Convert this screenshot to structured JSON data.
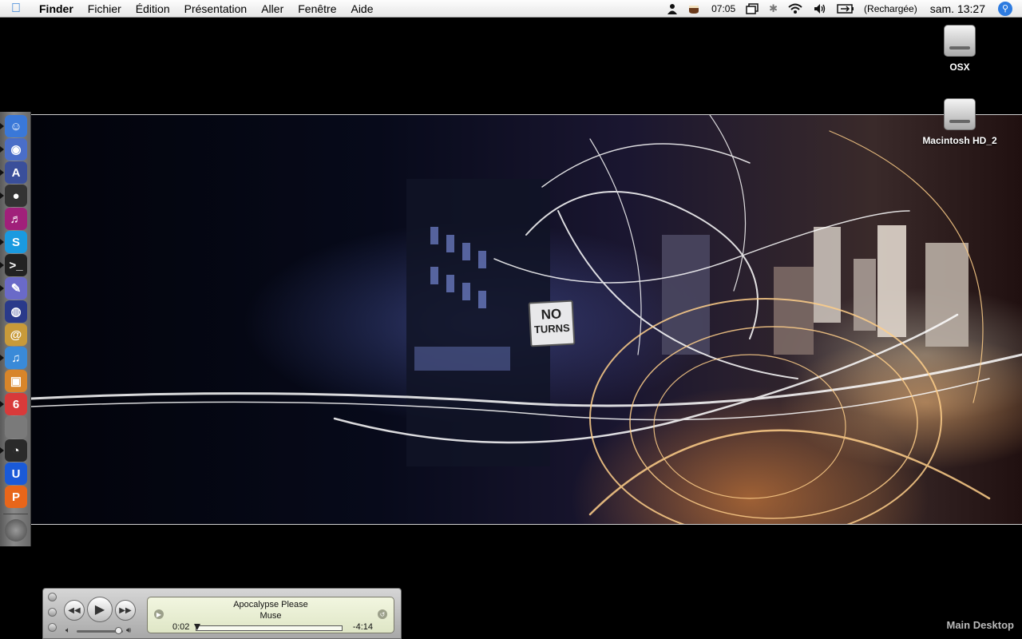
{
  "menubar": {
    "apple_icon": "apple-icon",
    "app_name": "Finder",
    "menus": [
      "Fichier",
      "Édition",
      "Présentation",
      "Aller",
      "Fenêtre",
      "Aide"
    ],
    "clock_alt": "07:05",
    "battery_status": "(Rechargée)",
    "clock": "sam. 13:27"
  },
  "wallpaper": {
    "sign_line1": "NO",
    "sign_line2": "TURNS"
  },
  "desktop": {
    "drives": [
      {
        "label": "OSX",
        "icon": "hard-drive-icon"
      },
      {
        "label": "Macintosh HD_2",
        "icon": "hard-drive-icon"
      }
    ],
    "desktop_name": "Main Desktop"
  },
  "dock": {
    "items": [
      {
        "name": "finder",
        "glyph": "☺",
        "color": "#3a78d8",
        "running": true
      },
      {
        "name": "firefox",
        "glyph": "◉",
        "color": "#4a6ec8",
        "running": true
      },
      {
        "name": "xcode",
        "glyph": "A",
        "color": "#3a4f9a",
        "running": true
      },
      {
        "name": "adium",
        "glyph": "●",
        "color": "#333333",
        "running": true
      },
      {
        "name": "itunes-alt",
        "glyph": "♬",
        "color": "#a0207a",
        "running": false
      },
      {
        "name": "skype",
        "glyph": "S",
        "color": "#1a9ae0",
        "running": true
      },
      {
        "name": "terminal",
        "glyph": ">_",
        "color": "#222222",
        "running": true
      },
      {
        "name": "script-editor",
        "glyph": "✎",
        "color": "#6a6ac8",
        "running": true
      },
      {
        "name": "network",
        "glyph": "◍",
        "color": "#2a3a8a",
        "running": false
      },
      {
        "name": "address-book",
        "glyph": "@",
        "color": "#c89a3a",
        "running": false
      },
      {
        "name": "itunes",
        "glyph": "♫",
        "color": "#3a8ad8",
        "running": true
      },
      {
        "name": "iphoto",
        "glyph": "▣",
        "color": "#d8852a",
        "running": false
      },
      {
        "name": "ical",
        "glyph": "6",
        "color": "#d83a3a",
        "running": true
      },
      {
        "name": "system-preferences",
        "glyph": "",
        "color": "#7a7a7a",
        "running": false
      },
      {
        "name": "time-machine",
        "glyph": "◔",
        "color": "#2a2a2a",
        "running": true
      },
      {
        "name": "audio-app",
        "glyph": "U",
        "color": "#1a5ad8",
        "running": false
      },
      {
        "name": "presentation-app",
        "glyph": "P",
        "color": "#e8661a",
        "running": false
      }
    ],
    "trash_icon": "trash-icon"
  },
  "mini_player": {
    "song": "Apocalypse Please",
    "artist": "Muse",
    "elapsed": "0:02",
    "remaining": "-4:14",
    "progress": 0.008,
    "volume": 0.9
  }
}
